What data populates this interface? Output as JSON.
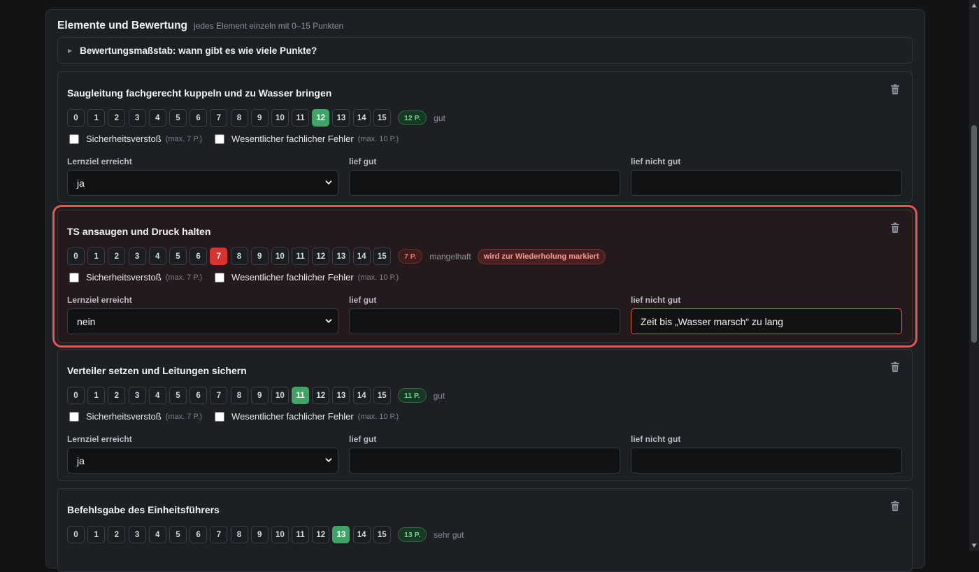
{
  "section": {
    "title": "Elemente und Bewertung",
    "subtitle": "jedes Element einzeln mit 0–15 Punkten",
    "details_summary": "Bewertungsmaßstab: wann gibt es wie viele Punkte?"
  },
  "score_options": [
    "0",
    "1",
    "2",
    "3",
    "4",
    "5",
    "6",
    "7",
    "8",
    "9",
    "10",
    "11",
    "12",
    "13",
    "14",
    "15"
  ],
  "labels": {
    "safety": "Sicherheitsverstoß",
    "safety_hint": "(max. 7 P.)",
    "error": "Wesentlicher fachlicher Fehler",
    "error_hint": "(max. 10 P.)",
    "goal": "Lernziel erreicht",
    "went_well": "lief gut",
    "went_bad": "lief nicht gut"
  },
  "elements": [
    {
      "title": "Saugleitung fachgerecht kuppeln und zu Wasser bringen",
      "score": 12,
      "points_label": "12 P.",
      "rating": "gut",
      "status": "good",
      "repeat_badge": "",
      "goal": "ja",
      "went_well": "",
      "went_bad": ""
    },
    {
      "title": "TS ansaugen und Druck halten",
      "score": 7,
      "points_label": "7 P.",
      "rating": "mangelhaft",
      "status": "bad",
      "repeat_badge": "wird zur Wiederholung markiert",
      "goal": "nein",
      "went_well": "",
      "went_bad": "Zeit bis „Wasser marsch“ zu lang"
    },
    {
      "title": "Verteiler setzen und Leitungen sichern",
      "score": 11,
      "points_label": "11 P.",
      "rating": "gut",
      "status": "good",
      "repeat_badge": "",
      "goal": "ja",
      "went_well": "",
      "went_bad": ""
    },
    {
      "title": "Befehlsgabe des Einheitsführers",
      "score": 13,
      "points_label": "13 P.",
      "rating": "sehr gut",
      "status": "good",
      "repeat_badge": "",
      "goal": "",
      "went_well": "",
      "went_bad": ""
    }
  ]
}
